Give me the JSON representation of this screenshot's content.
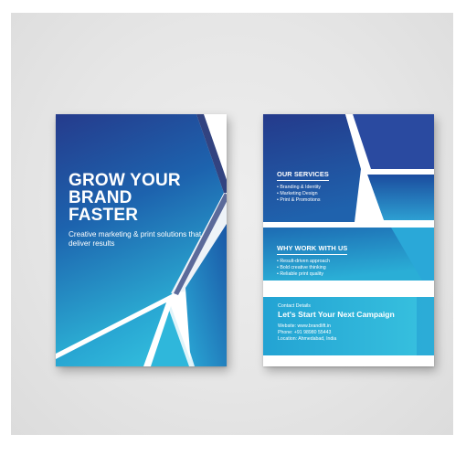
{
  "front": {
    "headline": "GROW YOUR\nBRAND\nFASTER",
    "subheadline": "Creative marketing & print solutions that deliver results"
  },
  "back": {
    "services": {
      "heading": "OUR SERVICES",
      "items": [
        "• Branding & Identity",
        "• Marketing Design",
        "• Print & Promotions"
      ]
    },
    "why": {
      "heading": "WHY WORK WITH US",
      "items": [
        "• Result-driven approach",
        "• Bold creative thinking",
        "• Reliable print quality"
      ]
    },
    "contact": {
      "label": "Contact Details",
      "title": "Let's Start Your Next Campaign",
      "website": "Website: www.brandlift.in",
      "phone": "Phone: +91 98980 55443",
      "location": "Location: Ahmedabad, India"
    }
  },
  "colors": {
    "background": "#e6e6e6",
    "navy": "#243c8c",
    "blue": "#1f72b6",
    "cyan": "#2bb3d6",
    "text": "#ffffff"
  }
}
